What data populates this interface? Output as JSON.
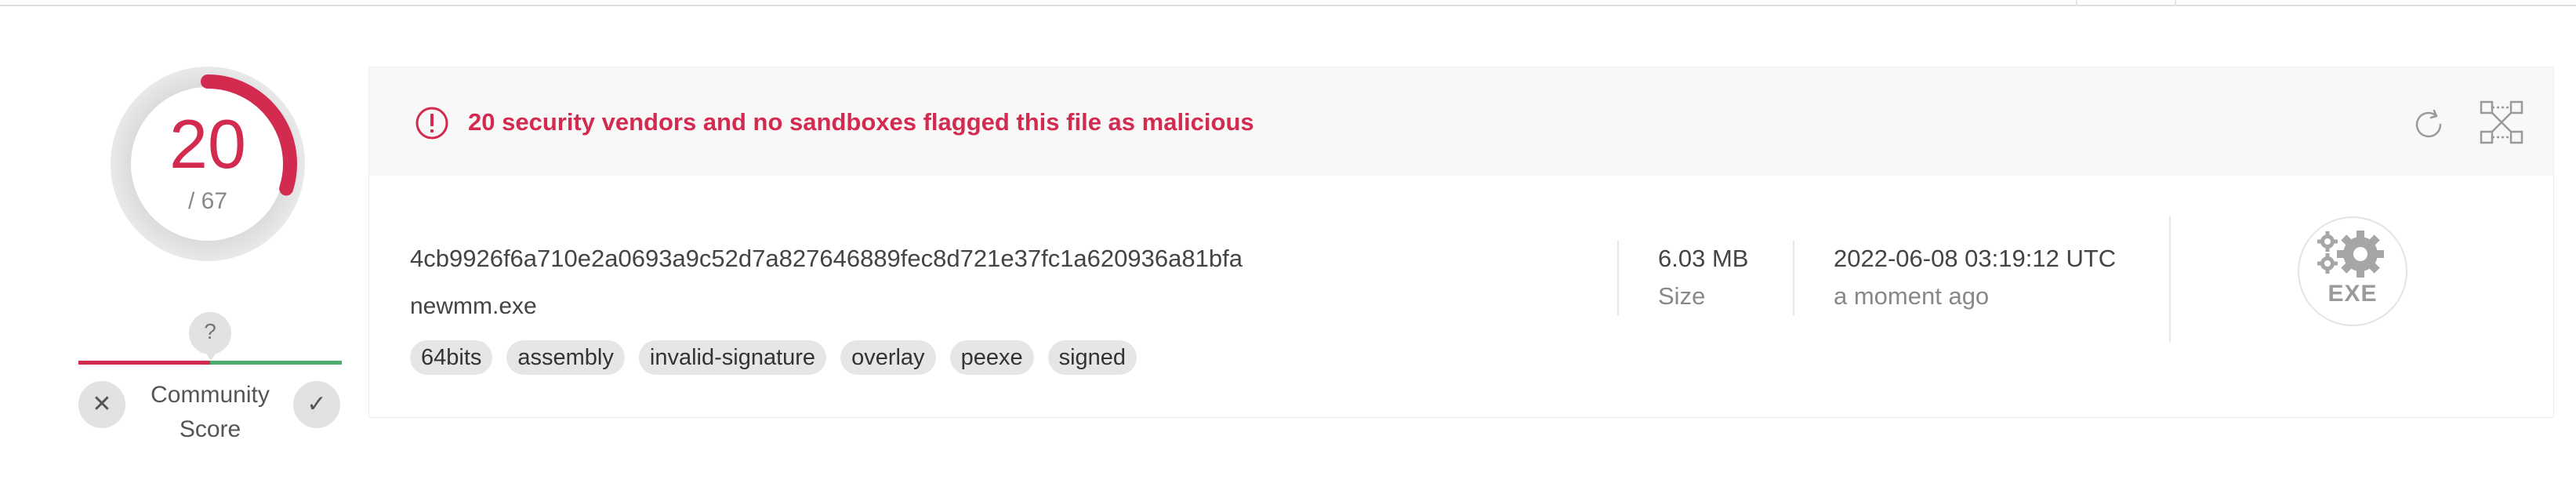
{
  "score": {
    "detections": "20",
    "total": "/ 67",
    "detections_count": 20,
    "total_count": 67,
    "accent_color": "#d32b4f"
  },
  "community": {
    "unknown_symbol": "?",
    "label": "Community Score",
    "label_line1": "Community",
    "label_line2": "Score",
    "vote_down_icon": "close-icon",
    "vote_up_icon": "checkmark-icon",
    "negative_color": "#d32b4f",
    "positive_color": "#4cae6a"
  },
  "alert": {
    "message": "20 security vendors and no sandboxes flagged this file as malicious",
    "icon": "alert-circle-icon",
    "color": "#d32b4f",
    "actions": [
      "reanalyze-icon",
      "similar-graph-icon"
    ]
  },
  "file": {
    "hash": "4cb9926f6a710e2a0693a9c52d7a827646889fec8d721e37fc1a620936a81bfa",
    "name": "newmm.exe",
    "tags": [
      "64bits",
      "assembly",
      "invalid-signature",
      "overlay",
      "peexe",
      "signed"
    ],
    "size_value": "6.03 MB",
    "size_label": "Size",
    "date_value": "2022-06-08 03:19:12 UTC",
    "date_relative": "a moment ago",
    "type_label": "EXE",
    "type_icon": "gears-icon"
  }
}
